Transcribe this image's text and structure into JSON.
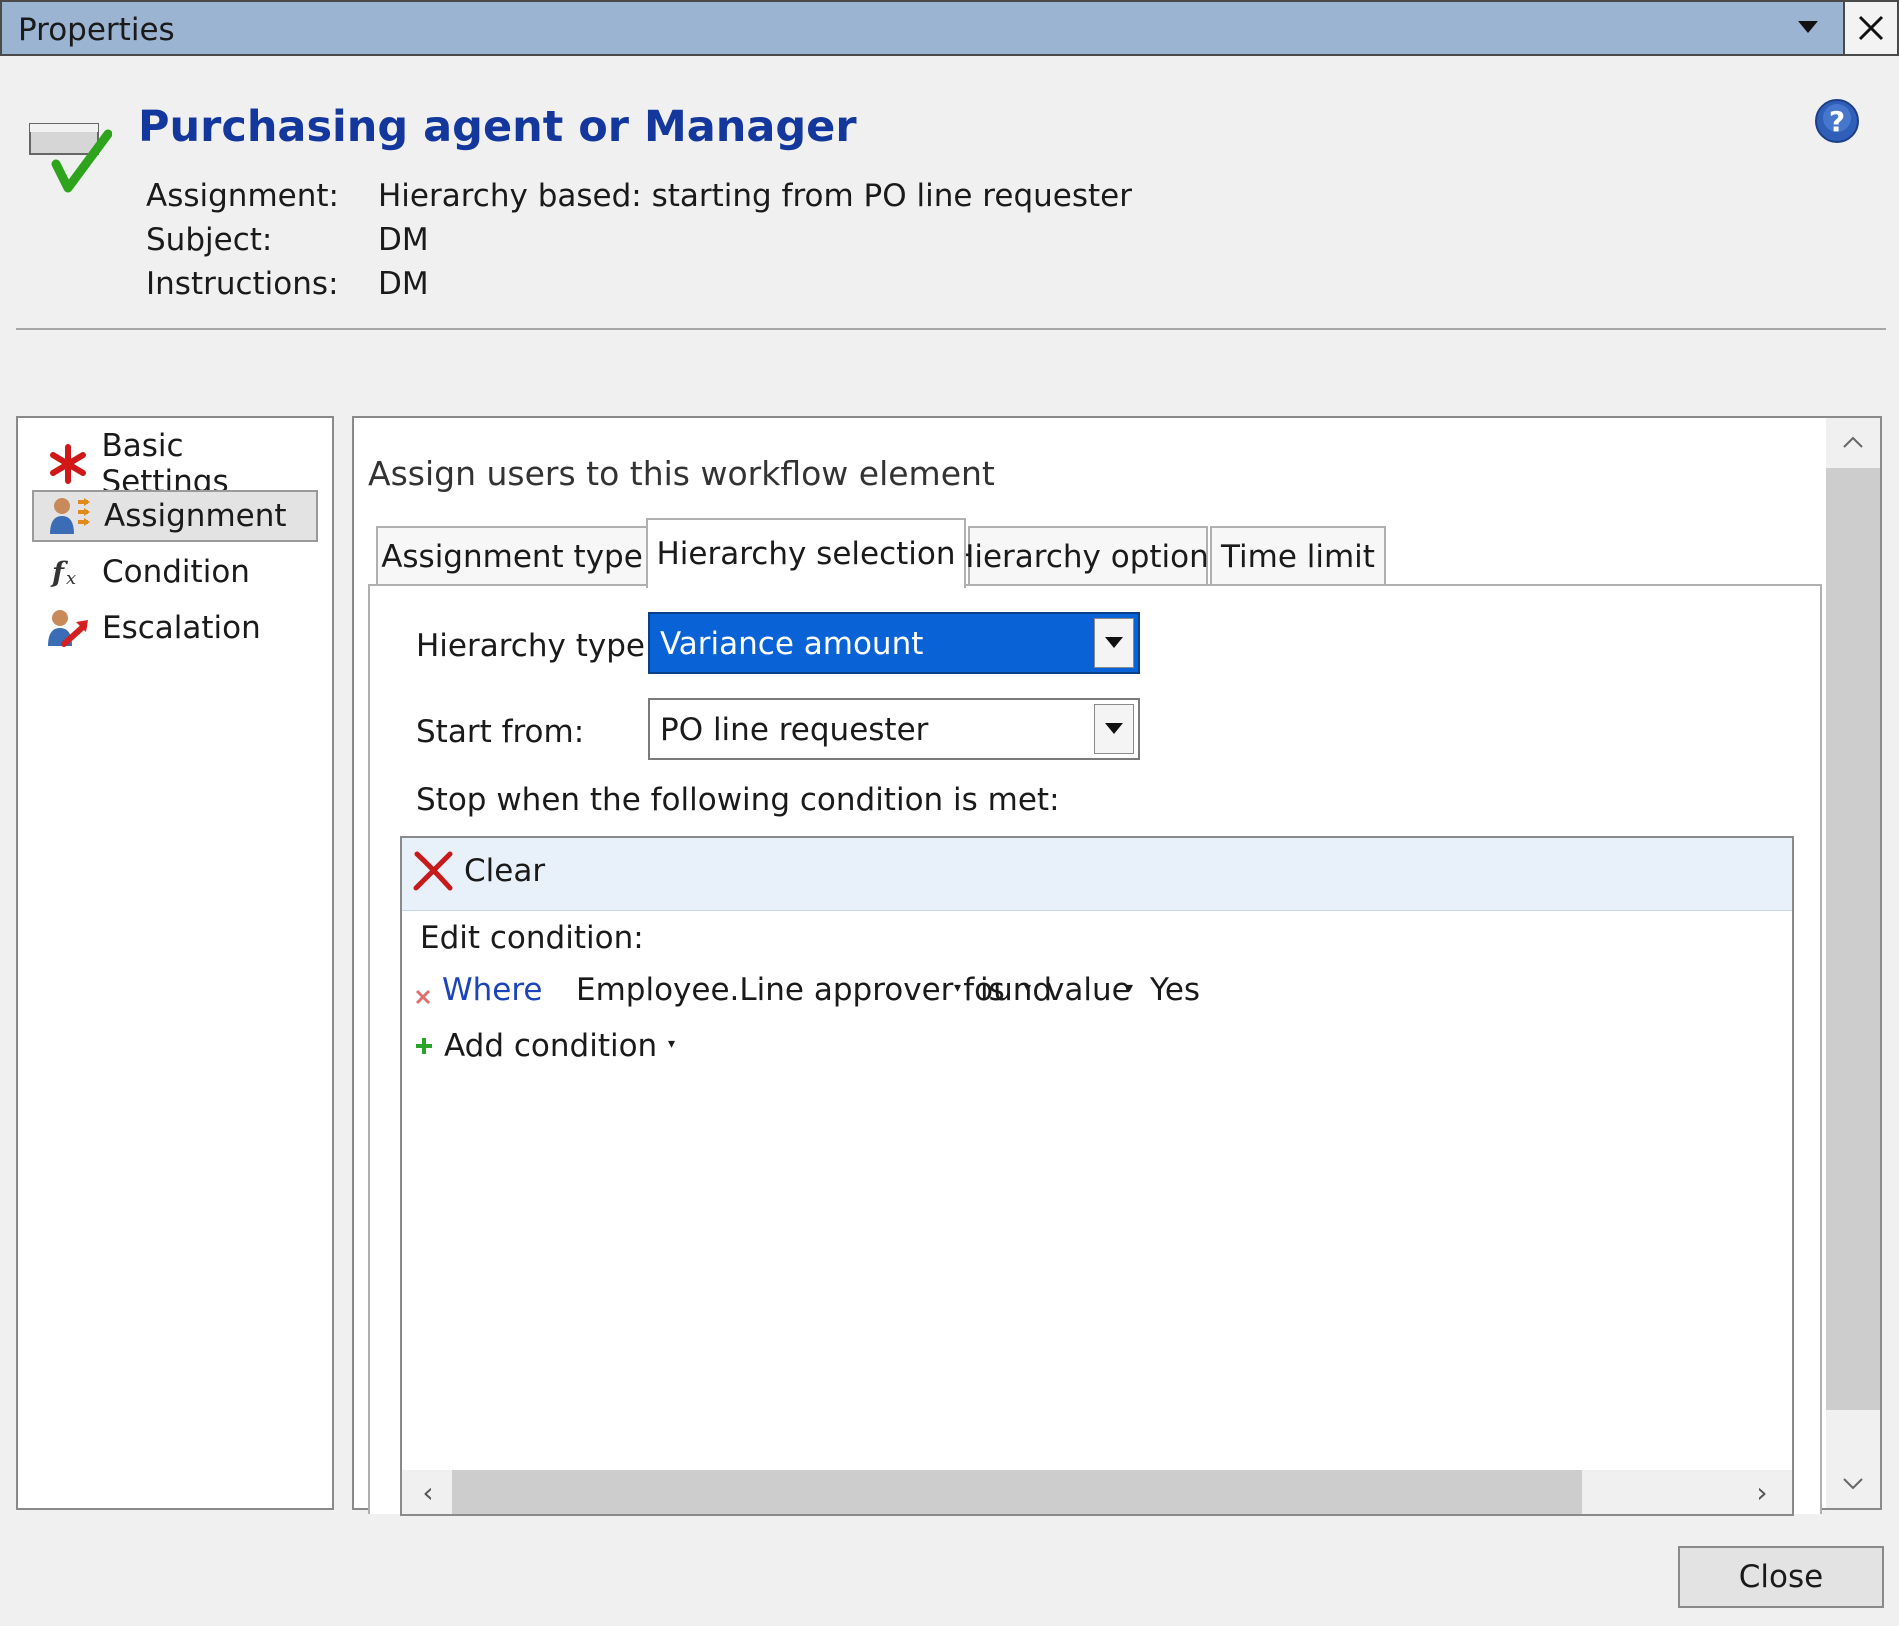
{
  "window": {
    "title": "Properties"
  },
  "header": {
    "title": "Purchasing agent or Manager",
    "rows": [
      {
        "label": "Assignment:",
        "value": "Hierarchy based: starting from PO line requester"
      },
      {
        "label": "Subject:",
        "value": "DM"
      },
      {
        "label": "Instructions:",
        "value": "DM"
      }
    ]
  },
  "nav": {
    "items": [
      {
        "label": "Basic Settings",
        "icon": "red-asterisk-icon"
      },
      {
        "label": "Assignment",
        "icon": "users-assignment-icon",
        "selected": true
      },
      {
        "label": "Condition",
        "icon": "function-fx-icon"
      },
      {
        "label": "Escalation",
        "icon": "user-escalation-icon"
      }
    ]
  },
  "main": {
    "heading": "Assign users to this workflow element",
    "tabs": [
      {
        "label": "Assignment type"
      },
      {
        "label": "Hierarchy selection",
        "active": true
      },
      {
        "label": "Hierarchy options"
      },
      {
        "label": "Time limit"
      }
    ],
    "hierarchy_type": {
      "label": "Hierarchy type:",
      "value": "Variance amount"
    },
    "start_from": {
      "label": "Start from:",
      "value": "PO line requester"
    },
    "stop_label": "Stop when the following condition is met:",
    "condition_editor": {
      "clear_label": "Clear",
      "edit_label": "Edit condition:",
      "condition": {
        "where": "Where",
        "field": "Employee.Line approver found",
        "operator": "is",
        "value_type": "value",
        "value": "Yes"
      },
      "add_label": "Add condition"
    }
  },
  "footer": {
    "close_label": "Close"
  },
  "colors": {
    "titlebar": "#9ab4d2",
    "title_text": "#13379c",
    "select_highlight": "#0a63d6",
    "where_link": "#1a44b8"
  }
}
